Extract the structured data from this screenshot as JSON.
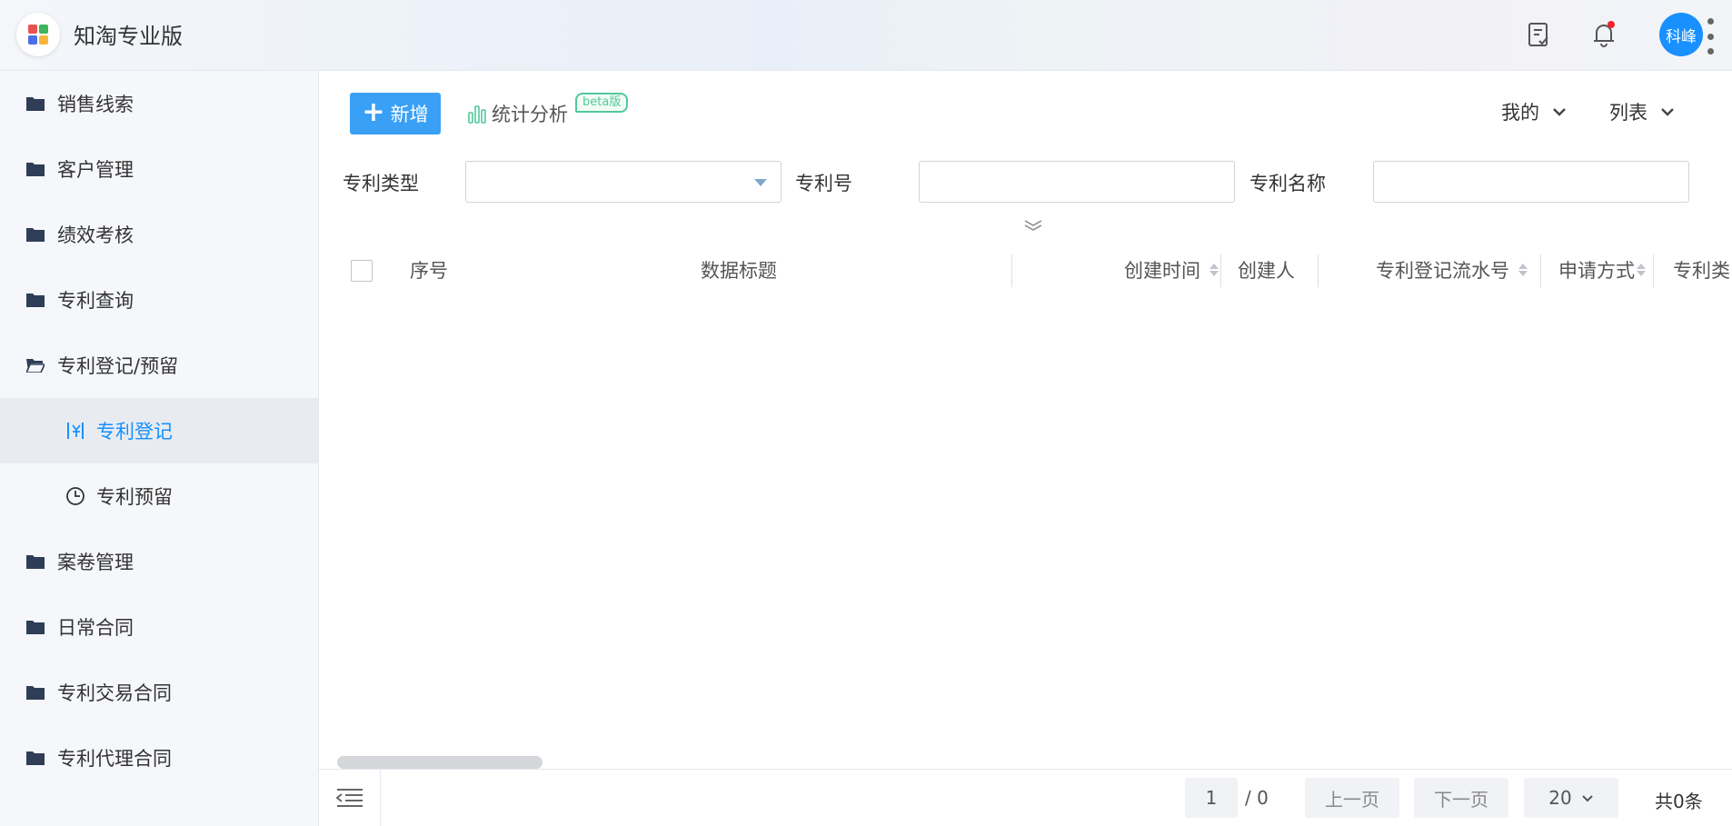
{
  "header": {
    "app_name": "知淘专业版",
    "avatar_text": "科峰",
    "logo_colors": [
      "#e8534f",
      "#3fb45a",
      "#4b6ee8",
      "#f5b73b"
    ],
    "notification_dot_color": "#f5222d"
  },
  "sidebar": {
    "items": [
      {
        "label": "销售线索",
        "icon": "folder-icon"
      },
      {
        "label": "客户管理",
        "icon": "folder-icon"
      },
      {
        "label": "绩效考核",
        "icon": "folder-icon"
      },
      {
        "label": "专利查询",
        "icon": "folder-icon"
      },
      {
        "label": "专利登记/预留",
        "icon": "folder-open-icon"
      },
      {
        "label": "专利登记",
        "icon": "register-icon",
        "active": true
      },
      {
        "label": "专利预留",
        "icon": "clock-icon"
      },
      {
        "label": "案卷管理",
        "icon": "folder-icon"
      },
      {
        "label": "日常合同",
        "icon": "folder-icon"
      },
      {
        "label": "专利交易合同",
        "icon": "folder-icon"
      },
      {
        "label": "专利代理合同",
        "icon": "folder-icon"
      }
    ],
    "active_color": "#1890ff"
  },
  "toolbar": {
    "add_label": "新增",
    "stat_label": "统计分析",
    "beta_label": "beta版",
    "scope_dropdown": "我的",
    "view_dropdown": "列表"
  },
  "filters": {
    "type_label": "专利类型",
    "type_value": "",
    "number_label": "专利号",
    "number_value": "",
    "name_label": "专利名称",
    "name_value": ""
  },
  "table": {
    "columns": [
      "序号",
      "数据标题",
      "创建时间",
      "创建人",
      "专利登记流水号",
      "申请方式",
      "专利类"
    ],
    "rows": []
  },
  "pagination": {
    "current_page": "1",
    "total_pages": "/ 0",
    "prev_label": "上一页",
    "next_label": "下一页",
    "page_size": "20",
    "total_count": "共0条"
  }
}
